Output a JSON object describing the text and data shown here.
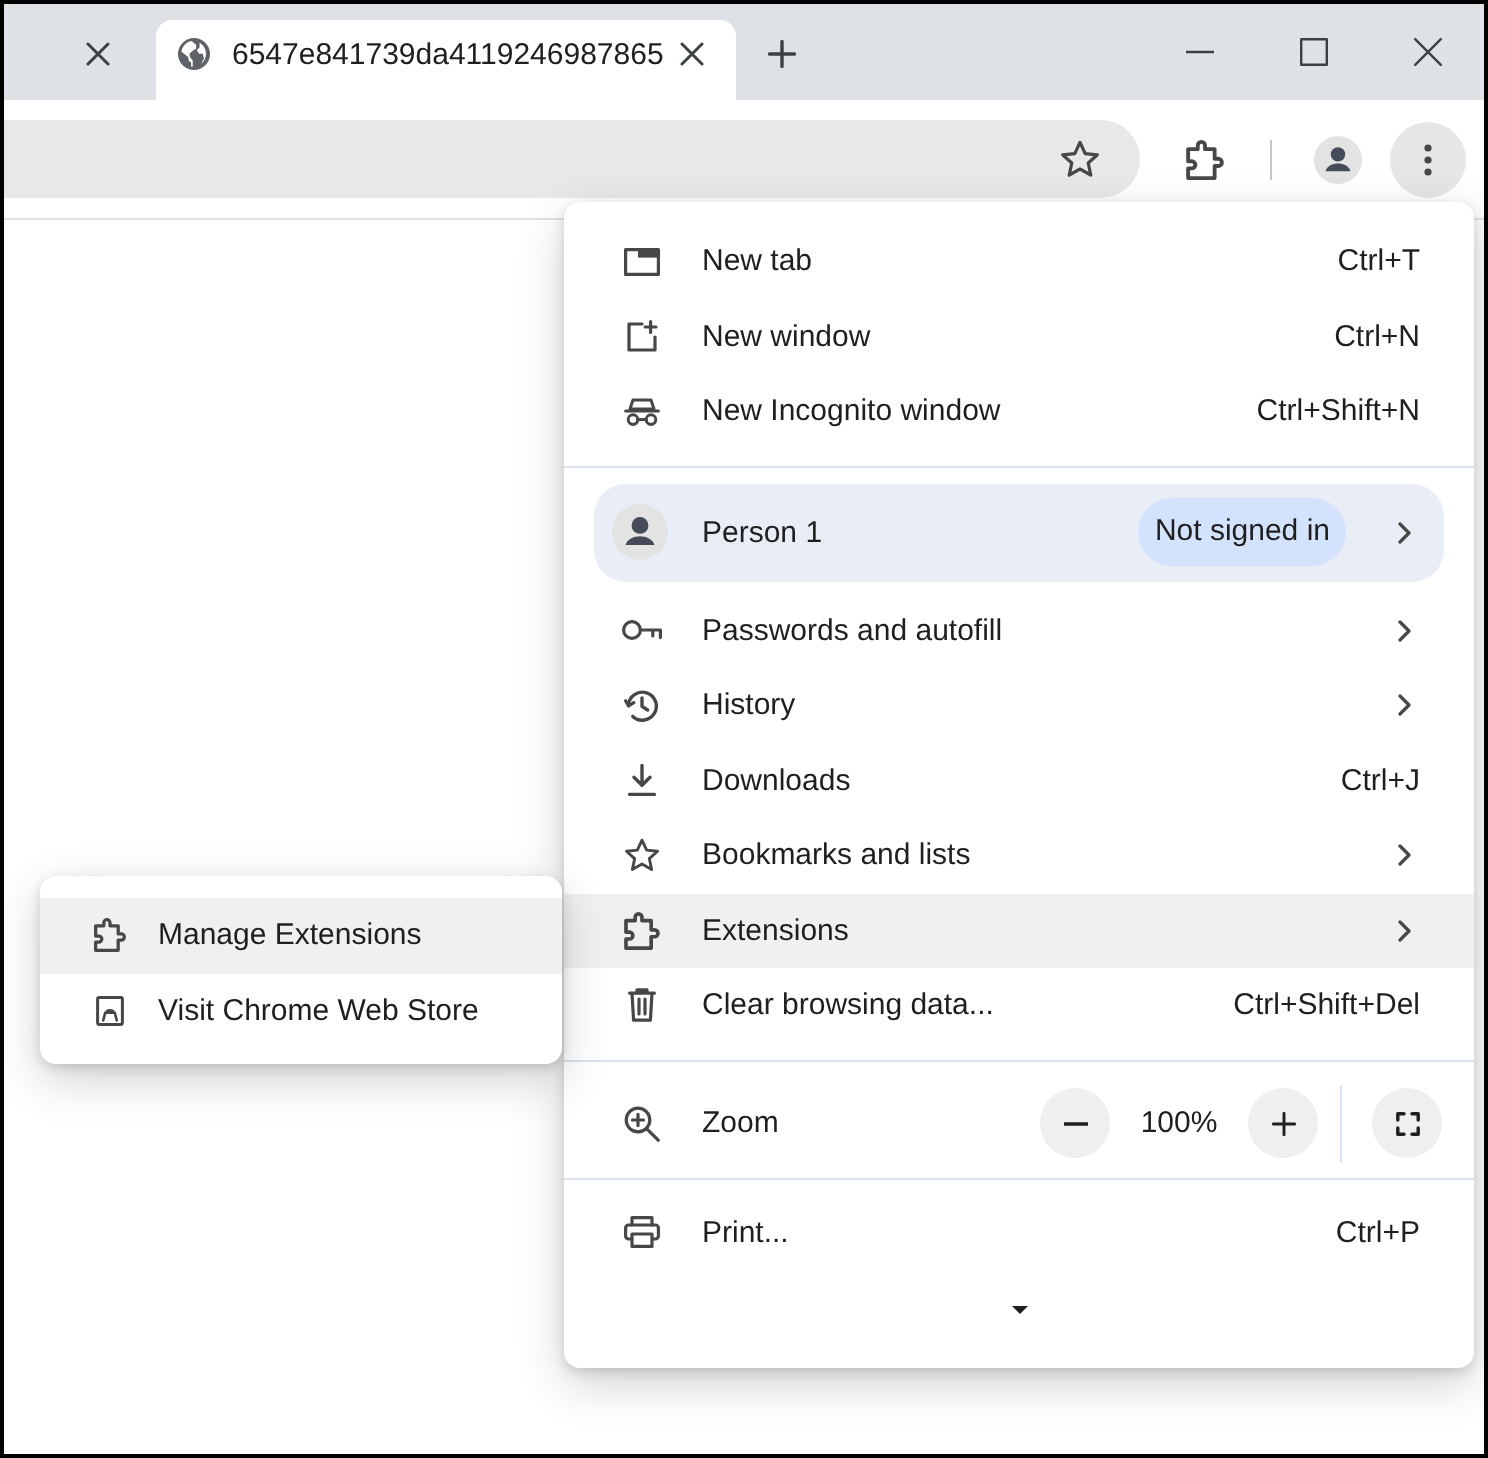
{
  "tabs": [
    {
      "selected": false
    },
    {
      "title": "6547e841739da4119246987865",
      "selected": true
    }
  ],
  "menu": {
    "items": [
      {
        "kind": "item",
        "label": "New tab",
        "shortcut": "Ctrl+T",
        "submenu": false,
        "highlighted": false
      },
      {
        "kind": "item",
        "label": "New window",
        "shortcut": "Ctrl+N",
        "submenu": false,
        "highlighted": false
      },
      {
        "kind": "item",
        "label": "New Incognito window",
        "shortcut": "Ctrl+Shift+N",
        "submenu": false,
        "highlighted": false
      },
      {
        "kind": "separator"
      },
      {
        "kind": "profile",
        "name": "Person 1",
        "status": "Not signed in"
      },
      {
        "kind": "item",
        "label": "Passwords and autofill",
        "submenu": true,
        "highlighted": false
      },
      {
        "kind": "item",
        "label": "History",
        "submenu": true,
        "highlighted": false
      },
      {
        "kind": "item",
        "label": "Downloads",
        "shortcut": "Ctrl+J",
        "submenu": false,
        "highlighted": false
      },
      {
        "kind": "item",
        "label": "Bookmarks and lists",
        "submenu": true,
        "highlighted": false
      },
      {
        "kind": "item",
        "label": "Extensions",
        "submenu": true,
        "highlighted": true
      },
      {
        "kind": "item",
        "label": "Clear browsing data...",
        "shortcut": "Ctrl+Shift+Del",
        "submenu": false,
        "highlighted": false
      },
      {
        "kind": "separator"
      },
      {
        "kind": "zoom",
        "label": "Zoom",
        "value": "100%"
      },
      {
        "kind": "separator"
      },
      {
        "kind": "item",
        "label": "Print...",
        "shortcut": "Ctrl+P",
        "submenu": false,
        "highlighted": false
      }
    ]
  },
  "submenu": {
    "items": [
      {
        "label": "Manage Extensions",
        "highlighted": true
      },
      {
        "label": "Visit Chrome Web Store",
        "highlighted": false
      }
    ]
  }
}
